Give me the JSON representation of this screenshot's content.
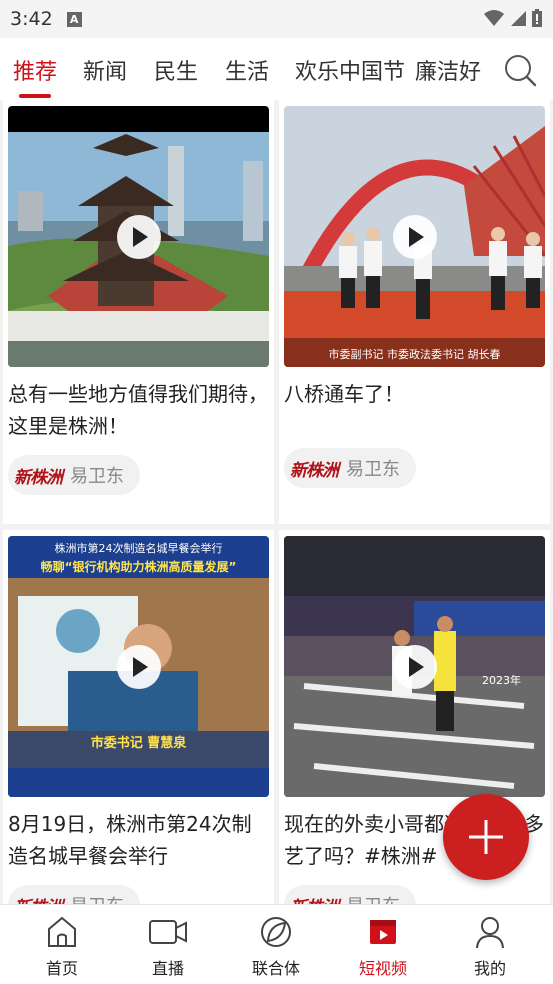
{
  "status_bar": {
    "time": "3:42"
  },
  "tabs": [
    {
      "label": "推荐",
      "active": true
    },
    {
      "label": "新闻"
    },
    {
      "label": "民生"
    },
    {
      "label": "生活"
    },
    {
      "label": "欢乐中国节"
    },
    {
      "label": "廉洁好"
    }
  ],
  "feed": [
    {
      "title": "总有一些地方值得我们期待，这里是株洲！",
      "author": "易卫东",
      "source_logo": "新株洲"
    },
    {
      "title": "八桥通车了！",
      "author": "易卫东",
      "source_logo": "新株洲",
      "overlay_text": "市委副书记 市委政法委书记 胡长春"
    },
    {
      "title": "8月19日，株洲市第24次制造名城早餐会举行",
      "author": "易卫东",
      "source_logo": "新株洲",
      "overlay_headline": "株洲市第24次制造名城早餐会举行",
      "overlay_subhead": "畅聊“银行机构助力株洲高质量发展”",
      "overlay_caption": "市委书记 曹慧泉"
    },
    {
      "title": "现在的外卖小哥都这么多才多艺了吗？#株洲#",
      "author": "易卫东",
      "source_logo": "新株洲",
      "overlay_text": "2023年"
    }
  ],
  "bottom_nav": [
    {
      "label": "首页"
    },
    {
      "label": "直播"
    },
    {
      "label": "联合体"
    },
    {
      "label": "短视频",
      "active": true
    },
    {
      "label": "我的"
    }
  ],
  "colors": {
    "accent": "#d0111b",
    "fab": "#cc1f1f"
  }
}
